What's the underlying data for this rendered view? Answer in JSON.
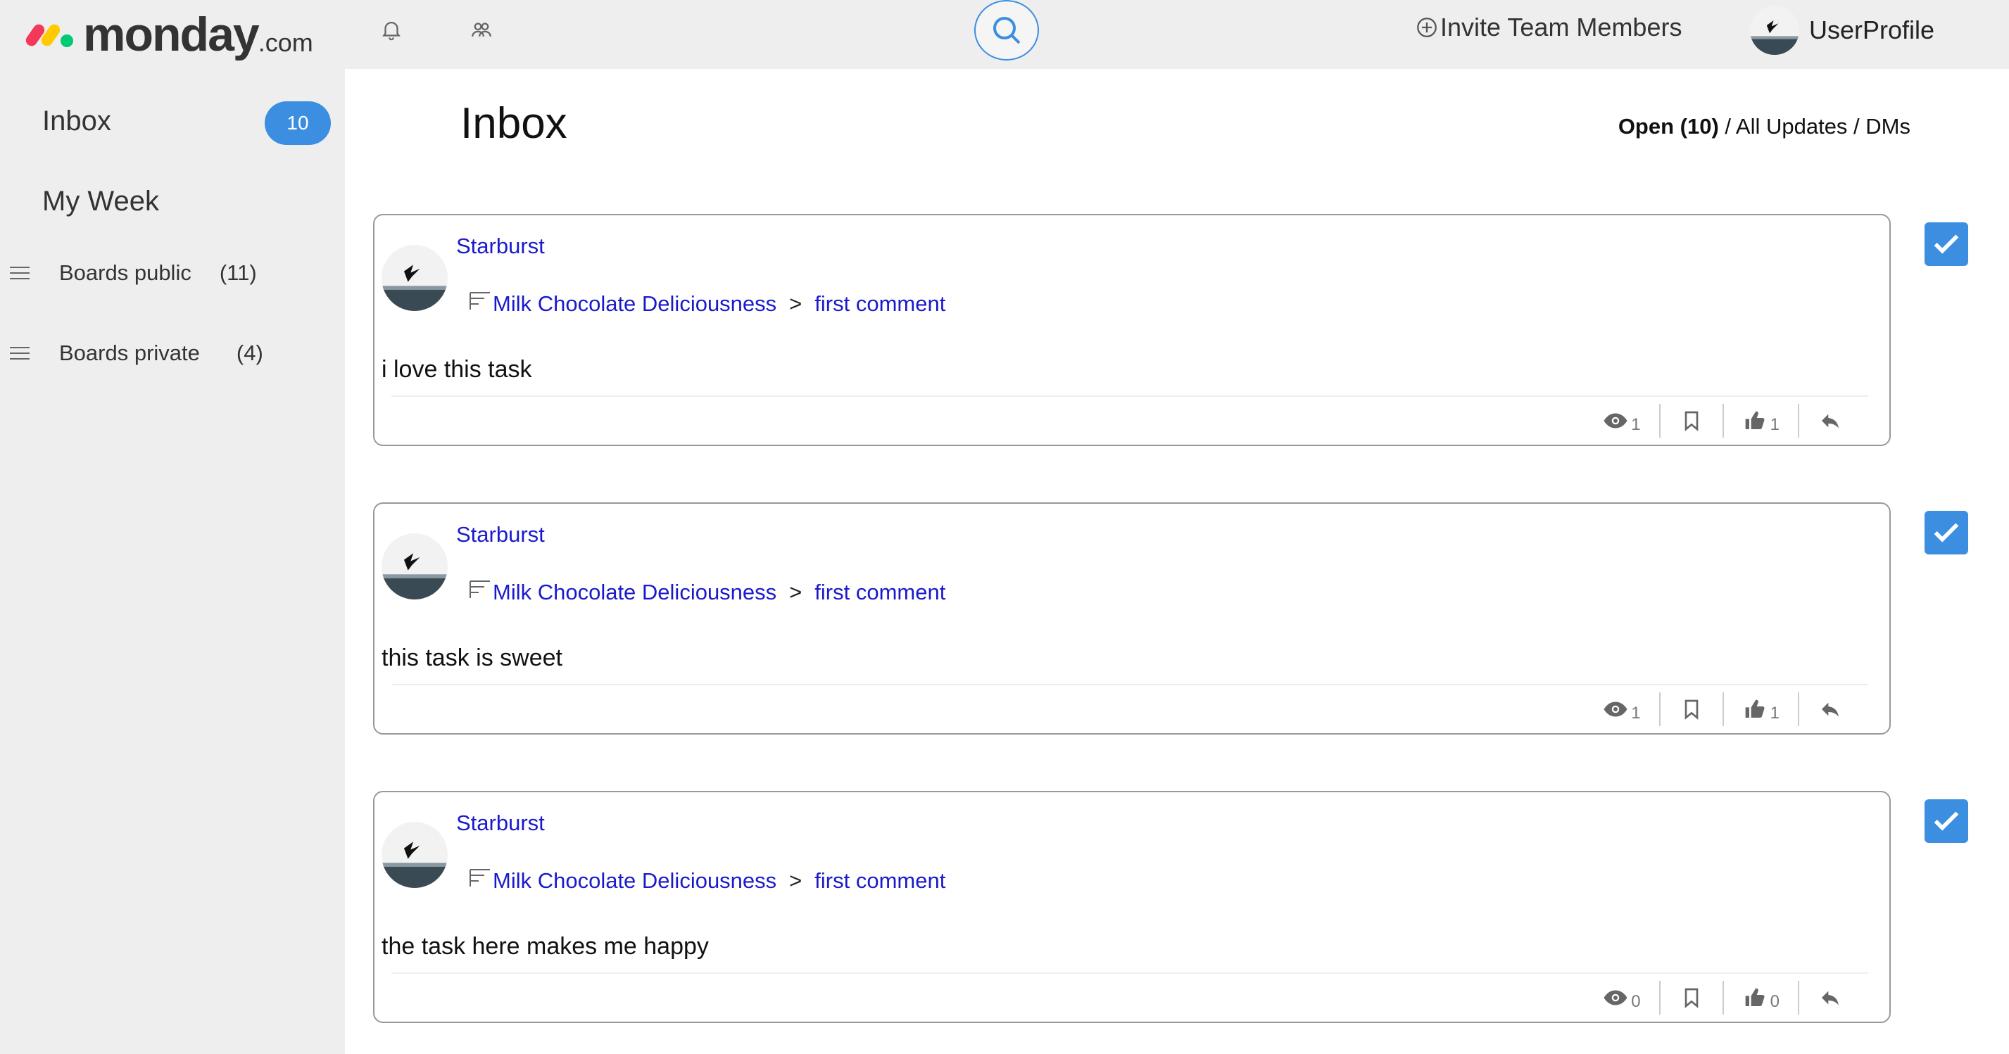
{
  "app": {
    "logo_word": "monday",
    "logo_suffix": ".com",
    "invite_label": "Invite Team Members",
    "profile_label": "UserProfile"
  },
  "icons": {
    "notifications": "bell-icon",
    "team": "people-icon",
    "search": "search-icon",
    "invite": "plus-circle-icon",
    "update": "update-lines-icon",
    "seen": "eye-icon",
    "bookmark": "bookmark-icon",
    "like": "thumbs-up-icon",
    "reply": "reply-icon",
    "done": "checkmark-icon"
  },
  "colors": {
    "accent": "#3b8ee0",
    "link": "#1a1acc",
    "sidebar_bg": "#eeeeee"
  },
  "sidebar": {
    "inbox_label": "Inbox",
    "inbox_count": "10",
    "my_week_label": "My Week",
    "boards": [
      {
        "label": "Boards public",
        "count": "(11)"
      },
      {
        "label": "Boards private",
        "count": "(4)"
      }
    ]
  },
  "main": {
    "title": "Inbox",
    "filter_open": "Open (10)",
    "filter_rest": " / All Updates / DMs"
  },
  "updates": [
    {
      "author": "Starburst",
      "board": "Milk Chocolate Deliciousness",
      "separator": ">",
      "item": "first comment",
      "text": "i love this task",
      "seen_count": "1",
      "like_count": "1",
      "checked": true
    },
    {
      "author": "Starburst",
      "board": "Milk Chocolate Deliciousness",
      "separator": ">",
      "item": "first comment",
      "text": "this task is sweet",
      "seen_count": "1",
      "like_count": "1",
      "checked": true
    },
    {
      "author": "Starburst",
      "board": "Milk Chocolate Deliciousness",
      "separator": ">",
      "item": "first comment",
      "text": "the task here makes me happy",
      "seen_count": "0",
      "like_count": "0",
      "checked": true
    }
  ]
}
